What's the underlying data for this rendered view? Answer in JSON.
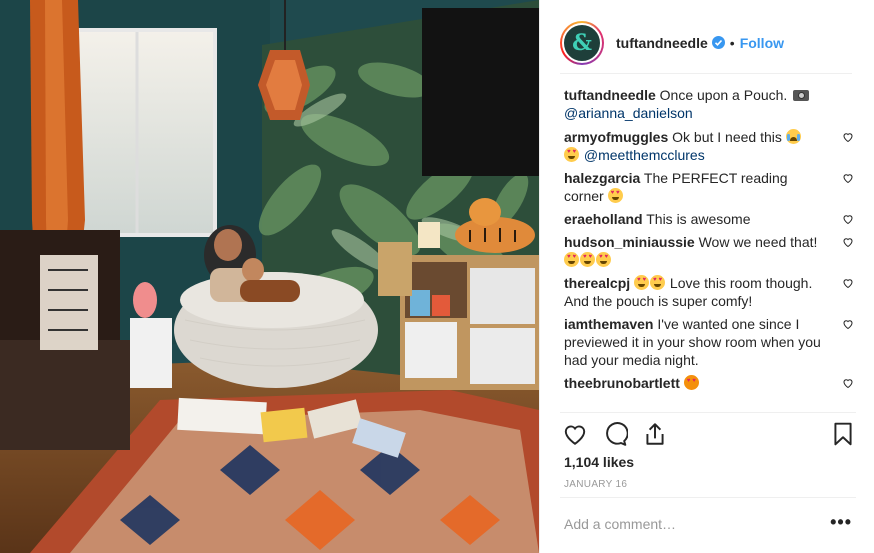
{
  "post": {
    "author": "tuftandneedle",
    "follow_label": "Follow",
    "separator": "•",
    "avatar_glyph": "&",
    "caption_text": "Once upon a Pouch.",
    "caption_mention": "@arianna_danielson",
    "likes_text": "1,104 likes",
    "date_text": "JANUARY 16",
    "add_comment_placeholder": "Add a comment…",
    "more_label": "•••"
  },
  "comments": [
    {
      "user": "armyofmuggles",
      "text_before": "Ok but I need this",
      "mention": "@meetthemcclures",
      "emojis": [
        "cry",
        "heart-eyes"
      ]
    },
    {
      "user": "halezgarcia",
      "text": "The PERFECT reading corner",
      "emojis": [
        "heart-eyes"
      ]
    },
    {
      "user": "eraeholland",
      "text": "This is awesome"
    },
    {
      "user": "hudson_miniaussie",
      "text": "Wow we need that!",
      "emojis": [
        "heart-eyes",
        "heart-eyes",
        "heart-eyes"
      ]
    },
    {
      "user": "therealcpj",
      "text": "Love this room though. And the pouch is super comfy!",
      "emojis": [
        "heart-eyes",
        "heart-eyes"
      ]
    },
    {
      "user": "iamthemaven",
      "text": "I've wanted one since I previewed it in your show room when you had your media night."
    },
    {
      "user": "theebrunobartlett",
      "emojis": [
        "heart-eyes-cat"
      ]
    }
  ],
  "icons": {
    "like": "heart-icon",
    "comment": "comment-icon",
    "share": "share-icon",
    "save": "bookmark-icon",
    "verified": "verified-badge-icon"
  },
  "colors": {
    "link_blue": "#3897f0",
    "mention_navy": "#003569",
    "text": "#262626",
    "muted": "#999999",
    "divider": "#efefef"
  }
}
